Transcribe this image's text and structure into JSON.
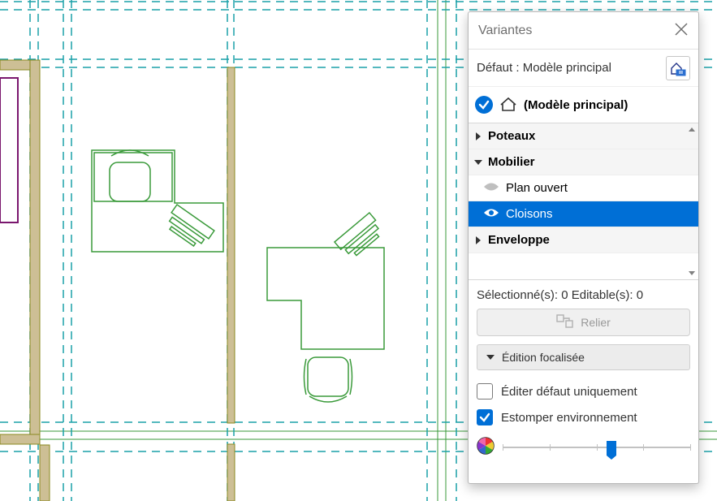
{
  "panel": {
    "title": "Variantes",
    "default_label": "Défaut : Modèle principal",
    "model_name": "(Modèle principal)"
  },
  "tree": {
    "items": [
      {
        "label": "Poteaux",
        "expanded": false
      },
      {
        "label": "Mobilier",
        "expanded": true,
        "children": [
          {
            "label": "Plan ouvert",
            "visible": false,
            "selected": false
          },
          {
            "label": "Cloisons",
            "visible": true,
            "selected": true
          }
        ]
      },
      {
        "label": "Enveloppe",
        "expanded": false
      }
    ]
  },
  "status": {
    "selected": 0,
    "editable": 0,
    "text": "Sélectionné(s): 0 Editable(s): 0"
  },
  "actions": {
    "link_label": "Relier",
    "section_label": "Édition focalisée"
  },
  "options": {
    "edit_default_only": {
      "label": "Éditer défaut uniquement",
      "checked": false
    },
    "dim_environment": {
      "label": "Estomper environnement",
      "checked": true
    }
  },
  "slider": {
    "value": 0.58
  },
  "icons": {
    "close": "close-icon",
    "model_options": "model-options-icon",
    "check": "check-icon",
    "house": "house-icon",
    "eye": "eye-icon",
    "chevron_right": "chevron-right-icon",
    "chevron_down": "chevron-down-icon",
    "link": "link-icon",
    "color_wheel": "color-wheel-icon"
  }
}
